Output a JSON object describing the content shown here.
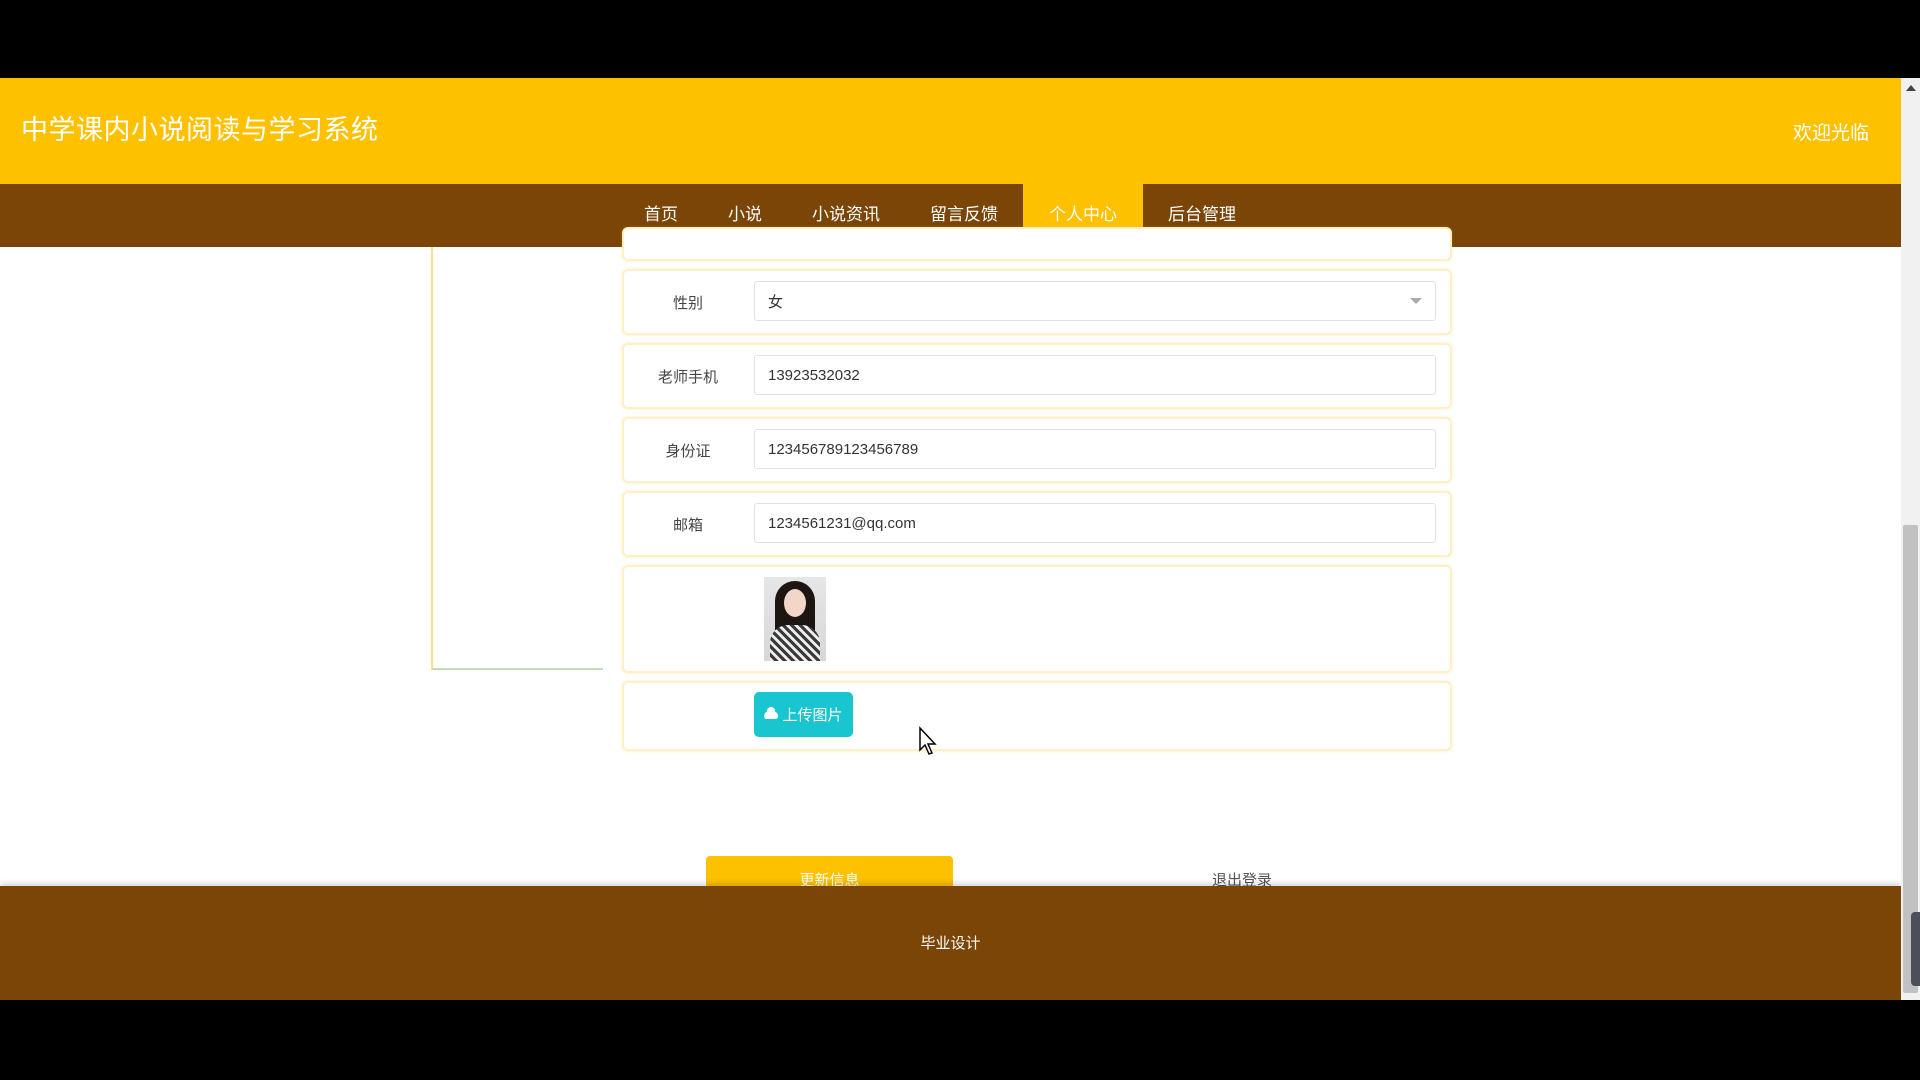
{
  "header": {
    "site_title": "中学课内小说阅读与学习系统",
    "welcome": "欢迎光临",
    "bg_color": "#fdc100"
  },
  "nav": {
    "bg_color": "#7a4506",
    "active_index": 4,
    "items": [
      {
        "label": "首页"
      },
      {
        "label": "小说"
      },
      {
        "label": "小说资讯"
      },
      {
        "label": "留言反馈"
      },
      {
        "label": "个人中心"
      },
      {
        "label": "后台管理"
      }
    ]
  },
  "form": {
    "gender": {
      "label": "性别",
      "value": "女"
    },
    "phone": {
      "label": "老师手机",
      "value": "13923532032"
    },
    "id_card": {
      "label": "身份证",
      "value": "123456789123456789"
    },
    "email": {
      "label": "邮箱",
      "value": "1234561231@qq.com"
    },
    "upload_label": "上传图片",
    "update_label": "更新信息",
    "logout_label": "退出登录",
    "accent_upload": "#19c6cf"
  },
  "footer": {
    "text": "毕业设计"
  }
}
